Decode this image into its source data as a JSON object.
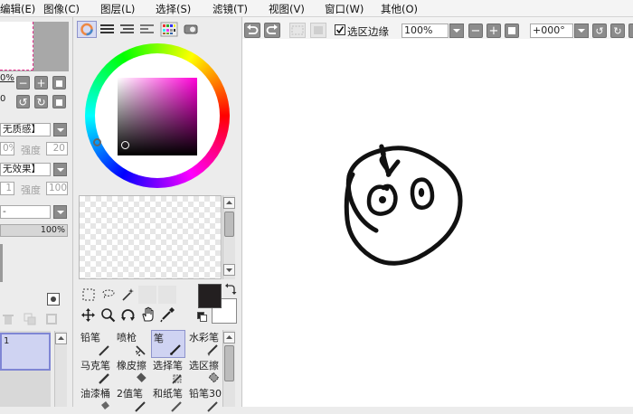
{
  "menubar": {
    "items": [
      {
        "label": "编辑(E)"
      },
      {
        "label": "图像(C)"
      },
      {
        "label": "图层(L)"
      },
      {
        "label": "选择(S)"
      },
      {
        "label": "滤镜(T)"
      },
      {
        "label": "视图(V)"
      },
      {
        "label": "窗口(W)"
      },
      {
        "label": "其他(O)"
      }
    ]
  },
  "left_panel": {
    "zoom_fragment": "0%",
    "texture_value": "无质感】",
    "texture_pct": "0%",
    "texture_strength_label": "强度",
    "texture_strength_value": "20",
    "effect_value": "无效果】",
    "effect_width": "1",
    "effect_strength_label": "强度",
    "effect_strength_value": "100",
    "opacity_value": "100%",
    "layer_number": "1"
  },
  "canvas_toolbar": {
    "selection_edge_label": "选区边缘",
    "selection_edge_checked": true,
    "zoom_value": "100%",
    "rotation_value": "+000°"
  },
  "color": {
    "foreground": "#231f20",
    "background": "#ffffff",
    "accent_selected": "#cfd3f2"
  },
  "tools": [
    {
      "label": "铅笔",
      "icon": "pencil-icon"
    },
    {
      "label": "喷枪",
      "icon": "airbrush-icon"
    },
    {
      "label": "笔",
      "icon": "pen-icon",
      "selected": true
    },
    {
      "label": "水彩笔",
      "icon": "watercolor-icon"
    },
    {
      "label": "马克笔",
      "icon": "marker-icon"
    },
    {
      "label": "橡皮擦",
      "icon": "eraser-icon"
    },
    {
      "label": "选择笔",
      "icon": "select-pen-icon"
    },
    {
      "label": "选区擦",
      "icon": "select-eraser-icon"
    },
    {
      "label": "油漆桶",
      "icon": "bucket-icon"
    },
    {
      "label": "2值笔",
      "icon": "binary-pen-icon"
    },
    {
      "label": "和纸笔",
      "icon": "washi-pen-icon"
    },
    {
      "label": "铅笔30",
      "icon": "pencil30-icon"
    }
  ]
}
